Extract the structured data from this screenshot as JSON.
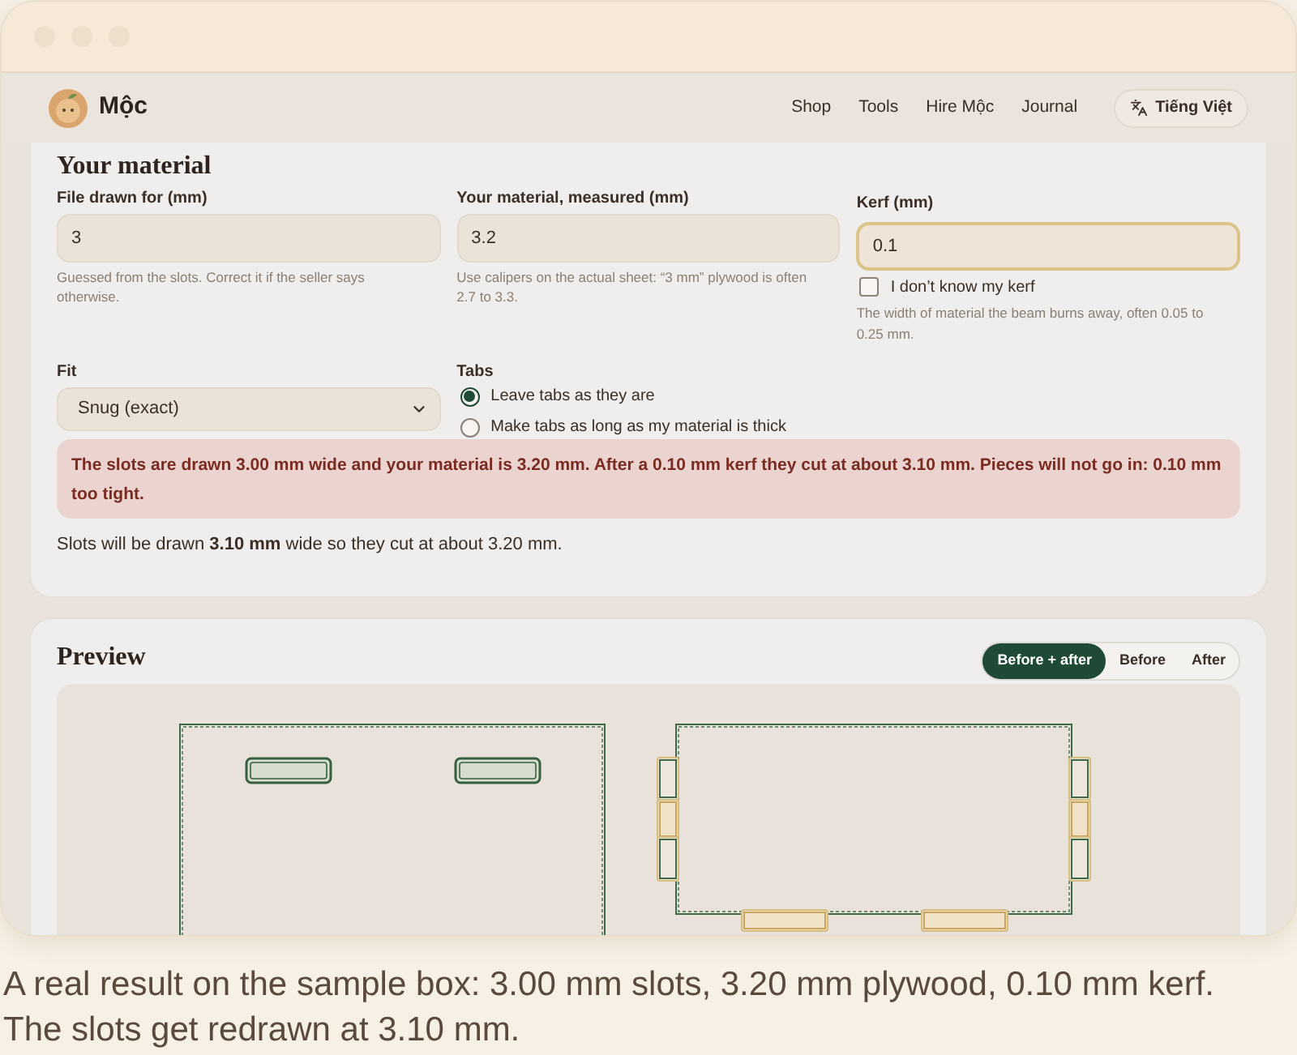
{
  "nav": {
    "brand": "Mộc",
    "links": [
      {
        "label": "Shop"
      },
      {
        "label": "Tools"
      },
      {
        "label": "Hire Mộc"
      },
      {
        "label": "Journal"
      }
    ],
    "language_button": "Tiếng Việt"
  },
  "material": {
    "title": "Your material",
    "fields": [
      {
        "label": "File drawn for (mm)",
        "value": "3",
        "focused": false,
        "help": "Guessed from the slots. Correct it if the seller says otherwise."
      },
      {
        "label": "Your material, measured (mm)",
        "value": "3.2",
        "focused": false,
        "help": "Use calipers on the actual sheet: “3 mm” plywood is often 2.7 to 3.3."
      },
      {
        "label": "Kerf (mm)",
        "value": "0.1",
        "focused": true,
        "checkbox": {
          "label": "I don’t know my kerf",
          "checked": false
        },
        "help": "The width of material the beam burns away, often 0.05 to 0.25 mm."
      }
    ],
    "fit": {
      "label": "Fit",
      "value": "Snug (exact)"
    },
    "tabs": {
      "label": "Tabs",
      "options": [
        {
          "label": "Leave tabs as they are",
          "selected": true
        },
        {
          "label": "Make tabs as long as my material is thick",
          "selected": false
        }
      ]
    },
    "alert": "The slots are drawn 3.00 mm wide and your material is 3.20 mm. After a 0.10 mm kerf they cut at about 3.10 mm. Pieces will not go in: 0.10 mm too tight.",
    "result": "Slots will be drawn **3.10 mm** wide so they cut at about 3.20 mm."
  },
  "preview": {
    "title": "Preview",
    "modes": [
      {
        "label": "Before + after",
        "selected": true
      },
      {
        "label": "Before",
        "selected": false
      },
      {
        "label": "After",
        "selected": false
      }
    ]
  },
  "caption": "A real result on the sample box: 3.00 mm slots, 3.20 mm plywood, 0.10 mm kerf. The slots get redrawn at 3.10 mm."
}
